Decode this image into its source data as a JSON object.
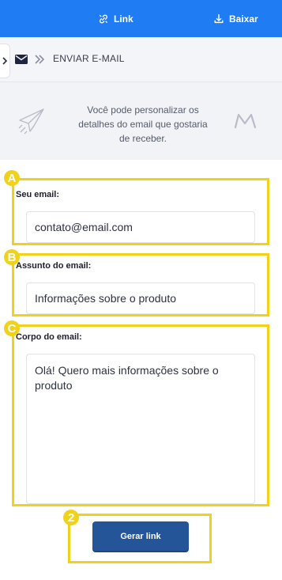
{
  "topbar": {
    "link_label": "Link",
    "download_label": "Baixar",
    "color": "#1f7cf2"
  },
  "breadcrumb": {
    "text": "ENVIAR E-MAIL"
  },
  "banner": {
    "text": "Você pode personalizar os detalhes do email que gostaria de receber."
  },
  "form": {
    "email": {
      "label": "Seu email:",
      "value": "contato@email.com"
    },
    "subject": {
      "label": "Assunto do email:",
      "value": "Informações sobre o produto"
    },
    "body": {
      "label": "Corpo do email:",
      "value": "Olá! Quero mais informações sobre o produto"
    }
  },
  "annotations": {
    "a": "A",
    "b": "B",
    "c": "C",
    "two": "2",
    "color": "#f0d21b"
  },
  "generate_button": {
    "label": "Gerar link",
    "color": "#245599"
  }
}
